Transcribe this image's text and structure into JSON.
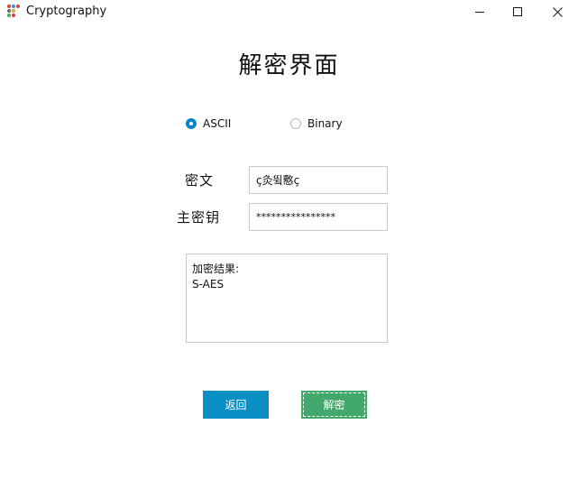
{
  "window": {
    "title": "Cryptography",
    "controls": {
      "minimize": "minimize-icon",
      "maximize": "maximize-icon",
      "close": "close-icon"
    }
  },
  "page": {
    "heading": "解密界面"
  },
  "mode": {
    "options": [
      {
        "label": "ASCII",
        "selected": true
      },
      {
        "label": "Binary",
        "selected": false
      }
    ]
  },
  "form": {
    "ciphertext_label": "密文",
    "ciphertext_value": "ç灸뜈懯ç",
    "key_label": "主密钥",
    "key_value": "****************"
  },
  "result": {
    "line1": "加密结果:",
    "line2": "S-AES"
  },
  "buttons": {
    "back_label": "返回",
    "decrypt_label": "解密"
  },
  "colors": {
    "accent_blue": "#0a8fc4",
    "accent_green": "#43a86b"
  }
}
